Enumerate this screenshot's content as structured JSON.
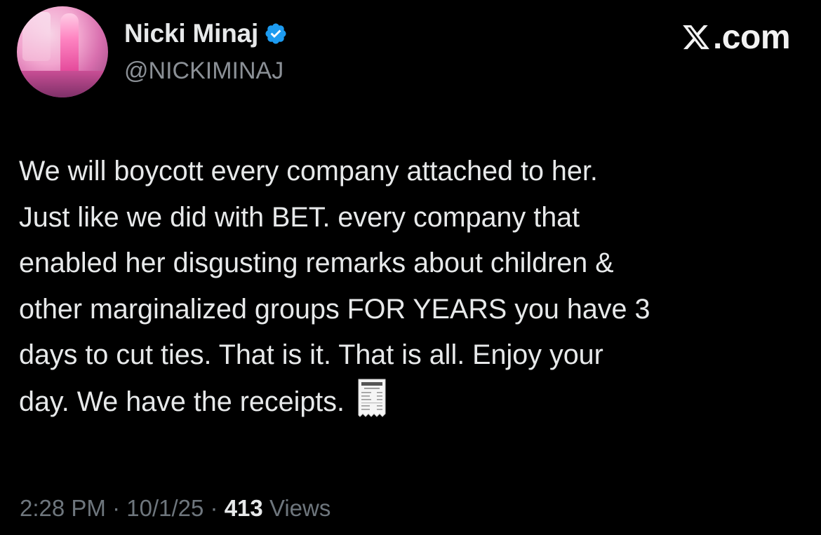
{
  "author": {
    "display_name": "Nicki Minaj",
    "handle": "@NICKIMINAJ",
    "verified": true
  },
  "brand": {
    "text": ".com",
    "icon": "x-logo-icon"
  },
  "tweet": {
    "lines": [
      "We will boycott every company attached to her.",
      "Just like we did with BET. every company that",
      "enabled her disgusting remarks about children &",
      "other marginalized groups FOR YEARS you have 3",
      "days to cut ties. That is it. That is all. Enjoy your",
      "day. We have the receipts."
    ],
    "emoji": "receipt-icon"
  },
  "meta": {
    "time": "2:28 PM",
    "separator": "·",
    "date": "10/1/25",
    "views_count": "413",
    "views_label": "Views"
  },
  "colors": {
    "background": "#000000",
    "primary_text": "#e7e9ea",
    "secondary_text": "#6e767d",
    "verified": "#1d9bf0"
  }
}
